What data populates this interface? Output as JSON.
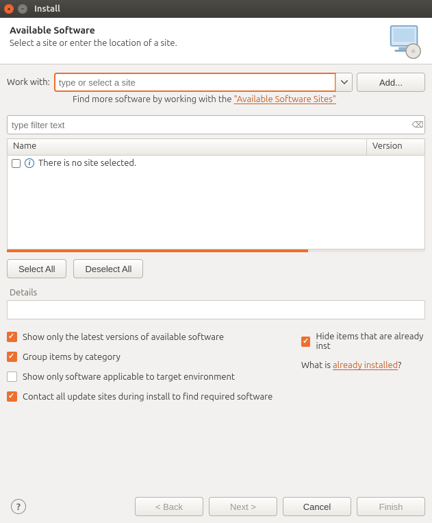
{
  "window": {
    "title": "Install"
  },
  "banner": {
    "heading": "Available Software",
    "subheading": "Select a site or enter the location of a site."
  },
  "work_with": {
    "label": "Work with:",
    "placeholder": "type or select a site",
    "add_button": "Add..."
  },
  "find_more": {
    "prefix": "Find more software by working with the ",
    "link": "\"Available Software Sites\""
  },
  "filter": {
    "placeholder": "type filter text"
  },
  "table": {
    "col_name": "Name",
    "col_version": "Version",
    "empty_message": "There is no site selected."
  },
  "buttons": {
    "select_all": "Select All",
    "deselect_all": "Deselect All"
  },
  "details": {
    "label": "Details"
  },
  "options": {
    "latest_only": "Show only the latest versions of available software",
    "group_by_cat": "Group items by category",
    "target_env": "Show only software applicable to target environment",
    "contact_sites": "Contact all update sites during install to find required software",
    "hide_installed": "Hide items that are already inst",
    "what_is_prefix": "What is ",
    "what_is_link": "already installed",
    "what_is_suffix": "?"
  },
  "footer": {
    "back": "< Back",
    "next": "Next >",
    "cancel": "Cancel",
    "finish": "Finish"
  }
}
